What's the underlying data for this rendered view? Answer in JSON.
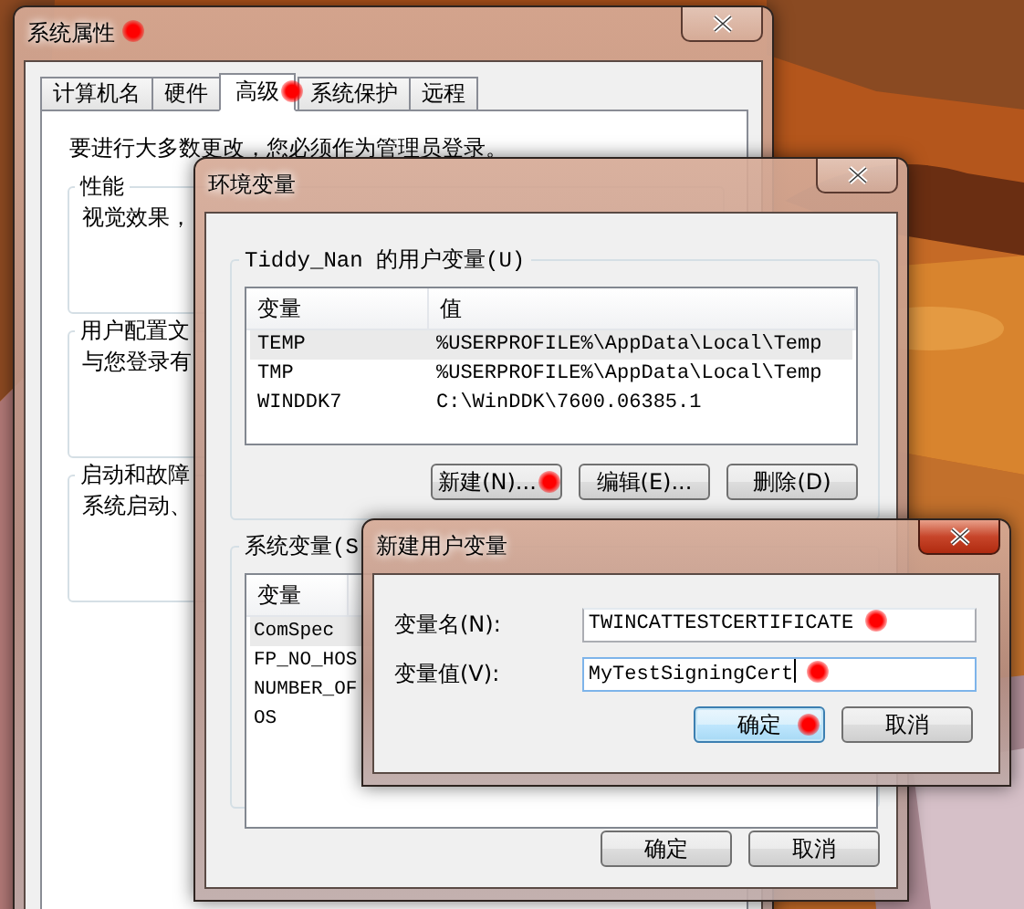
{
  "system_properties": {
    "title": "系统属性",
    "marked": true,
    "tabs": [
      {
        "label": "计算机名",
        "selected": false,
        "marked": false
      },
      {
        "label": "硬件",
        "selected": false,
        "marked": false
      },
      {
        "label": "高级",
        "selected": true,
        "marked": true
      },
      {
        "label": "系统保护",
        "selected": false,
        "marked": false
      },
      {
        "label": "远程",
        "selected": false,
        "marked": false
      }
    ],
    "notice": "要进行大多数更改，您必须作为管理员登录。",
    "groups": [
      {
        "title": "性能",
        "text": "视觉效果，"
      },
      {
        "title": "用户配置文",
        "text": "与您登录有"
      },
      {
        "title": "启动和故障",
        "text": "系统启动、"
      }
    ]
  },
  "environment_variables": {
    "title": "环境变量",
    "user_variables": {
      "title": "Tiddy_Nan 的用户变量(U)",
      "columns": [
        "变量",
        "值"
      ],
      "rows": [
        {
          "name": "TEMP",
          "value": "%USERPROFILE%\\AppData\\Local\\Temp",
          "selected": true
        },
        {
          "name": "TMP",
          "value": "%USERPROFILE%\\AppData\\Local\\Temp",
          "selected": false
        },
        {
          "name": "WINDDK7",
          "value": "C:\\WinDDK\\7600.06385.1",
          "selected": false
        }
      ],
      "buttons": [
        {
          "label": "新建(N)...",
          "marked": true
        },
        {
          "label": "编辑(E)...",
          "marked": false
        },
        {
          "label": "删除(D)",
          "marked": false
        }
      ]
    },
    "system_variables": {
      "title": "系统变量(S",
      "columns": [
        "变量"
      ],
      "rows": [
        {
          "name": "ComSpec",
          "selected": true
        },
        {
          "name": "FP_NO_HOS",
          "selected": false
        },
        {
          "name": "NUMBER_OF",
          "selected": false
        },
        {
          "name": "OS",
          "selected": false
        }
      ]
    },
    "buttons": [
      {
        "label": "确定"
      },
      {
        "label": "取消"
      }
    ]
  },
  "new_user_variable": {
    "title": "新建用户变量",
    "fields": [
      {
        "label": "变量名(N):",
        "value": "TWINCATTESTCERTIFICATE",
        "focused": false,
        "marked": true
      },
      {
        "label": "变量值(V):",
        "value": "MyTestSigningCert",
        "focused": true,
        "marked": true
      }
    ],
    "buttons": [
      {
        "label": "确定",
        "default": true,
        "marked": true
      },
      {
        "label": "取消",
        "default": false,
        "marked": false
      }
    ]
  }
}
